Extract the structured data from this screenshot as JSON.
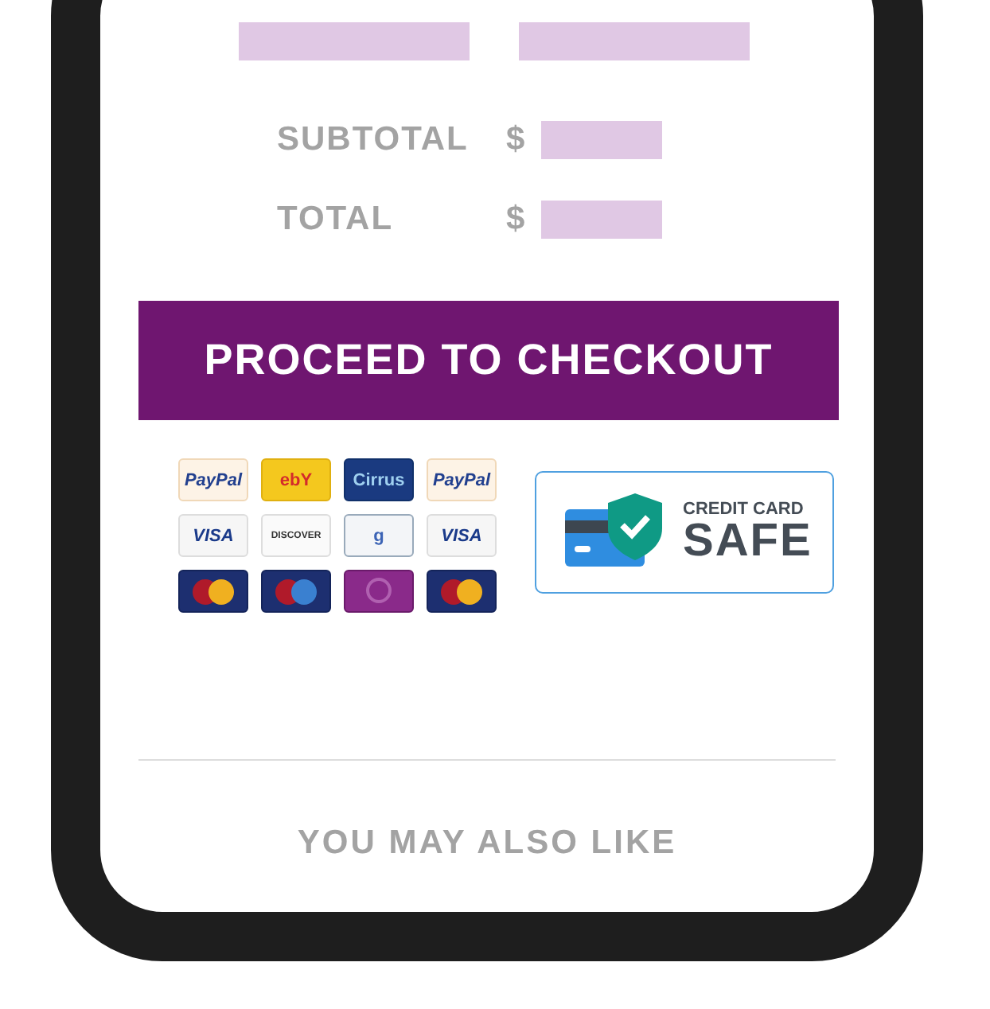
{
  "summary": {
    "rows": [
      {
        "label": "SUBTOTAL",
        "currency": "$"
      },
      {
        "label": "TOTAL",
        "currency": "$"
      }
    ]
  },
  "checkout_button": {
    "label": "PROCEED TO CHECKOUT"
  },
  "payment_cards": [
    {
      "kind": "paypal",
      "label": "PayPal"
    },
    {
      "kind": "ebay",
      "label": "ebY"
    },
    {
      "kind": "cirrus",
      "label": "Cirrus"
    },
    {
      "kind": "paypal",
      "label": "PayPal"
    },
    {
      "kind": "visa",
      "label": "VISA"
    },
    {
      "kind": "discover",
      "label": "DISCOVER"
    },
    {
      "kind": "google",
      "label": "g"
    },
    {
      "kind": "visa",
      "label": "VISA"
    },
    {
      "kind": "mastercard"
    },
    {
      "kind": "maestro"
    },
    {
      "kind": "solo"
    },
    {
      "kind": "mastercard"
    }
  ],
  "safe_badge": {
    "caption": "CREDIT CARD",
    "title": "SAFE"
  },
  "section_heading": "YOU MAY ALSO LIKE"
}
